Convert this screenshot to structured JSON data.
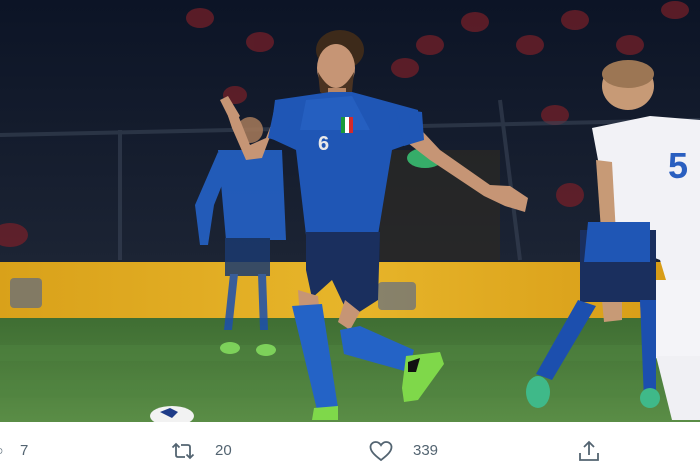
{
  "photo": {
    "description_icon": "football-match-photo"
  },
  "actions": {
    "reply_count": "7",
    "retweet_count": "20",
    "like_count": "339",
    "reply_icon": "reply-icon",
    "retweet_icon": "retweet-icon",
    "like_icon": "heart-icon",
    "share_icon": "share-icon"
  },
  "colors": {
    "action_gray": "#536471",
    "italy_blue": "#1f56b5",
    "pitch_green": "#4a7f3b"
  }
}
